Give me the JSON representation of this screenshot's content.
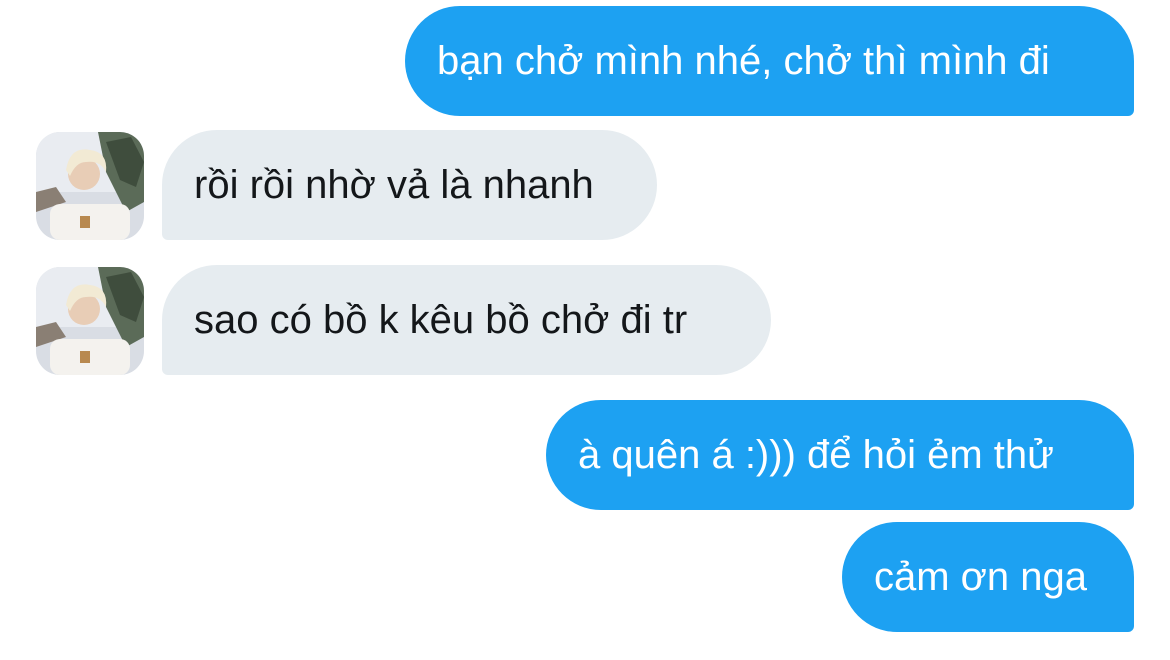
{
  "messages": [
    {
      "direction": "outgoing",
      "text": "bạn chở mình nhé, chở thì mình đi"
    },
    {
      "direction": "incoming",
      "text": "rồi rồi nhờ vả là nhanh"
    },
    {
      "direction": "incoming",
      "text": "sao có bồ k kêu bồ chở đi tr"
    },
    {
      "direction": "outgoing",
      "text": "à quên á :))) để hỏi ẻm thử"
    },
    {
      "direction": "outgoing",
      "text": "cảm ơn nga"
    }
  ],
  "colors": {
    "outgoing_bubble": "#1da1f2",
    "incoming_bubble": "#e6ecf0",
    "outgoing_text": "#ffffff",
    "incoming_text": "#14171a"
  },
  "icons": {
    "avatar": "contact-photo-avatar"
  }
}
